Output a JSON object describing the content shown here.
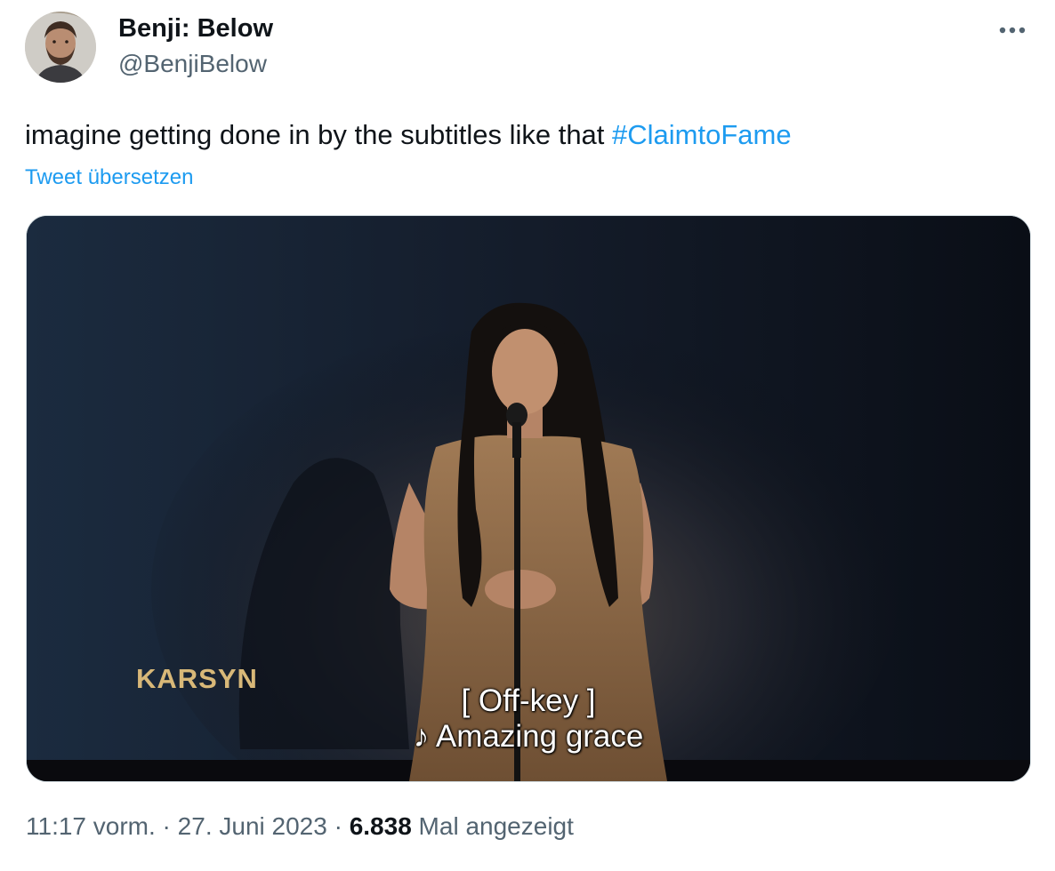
{
  "author": {
    "display_name": "Benji: Below",
    "handle": "@BenjiBelow"
  },
  "tweet": {
    "text_before": "imagine getting done in by the subtitles like that ",
    "hashtag": "#ClaimtoFame",
    "translate_label": "Tweet übersetzen"
  },
  "media": {
    "name_lower_third": "KARSYN",
    "subtitle_line_1": "[ Off-key ]",
    "subtitle_line_2": "♪ Amazing grace"
  },
  "meta": {
    "time": "11:17 vorm.",
    "separator_1": " · ",
    "date": "27. Juni 2023",
    "separator_2": " · ",
    "views": "6.838",
    "views_label": " Mal angezeigt"
  },
  "icons": {
    "more": "more-horizontal-icon"
  },
  "colors": {
    "link": "#1d9bf0",
    "secondary_text": "#536471",
    "primary_text": "#0f1419",
    "lower_third_gold": "#d8b878"
  }
}
